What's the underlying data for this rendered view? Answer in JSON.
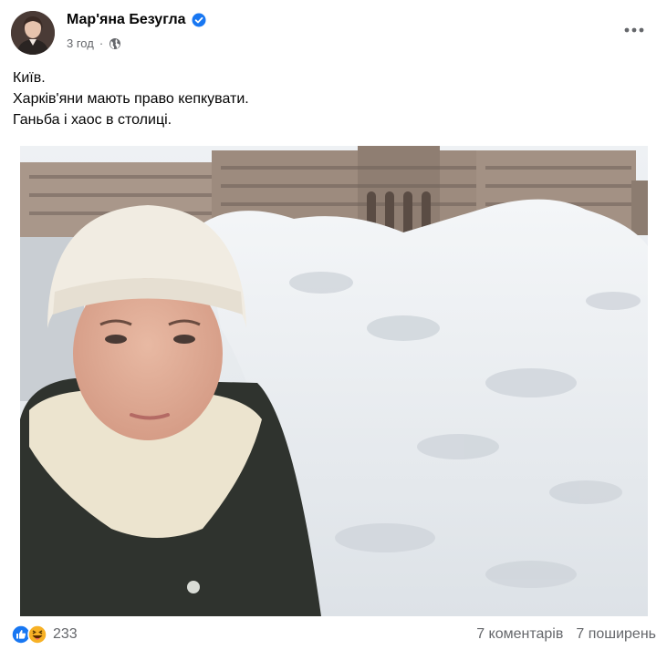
{
  "post": {
    "author_name": "Мар'яна Безугла",
    "time": "3 год",
    "separator": "·",
    "text_lines": [
      "Київ.",
      "Харків'яни мають право кепкувати.",
      "Ганьба і хаос в столиці."
    ]
  },
  "footer": {
    "reaction_count": "233",
    "comments": "7 коментарів",
    "shares": "7 поширень"
  },
  "icons": {
    "verified": "verified-badge-icon",
    "audience": "globe-icon",
    "more": "more-options-icon",
    "reactions": [
      "like-reaction-icon",
      "haha-reaction-icon"
    ]
  },
  "colors": {
    "accent": "#1877f2",
    "secondary_text": "#65676b",
    "haha": "#f7b125"
  }
}
